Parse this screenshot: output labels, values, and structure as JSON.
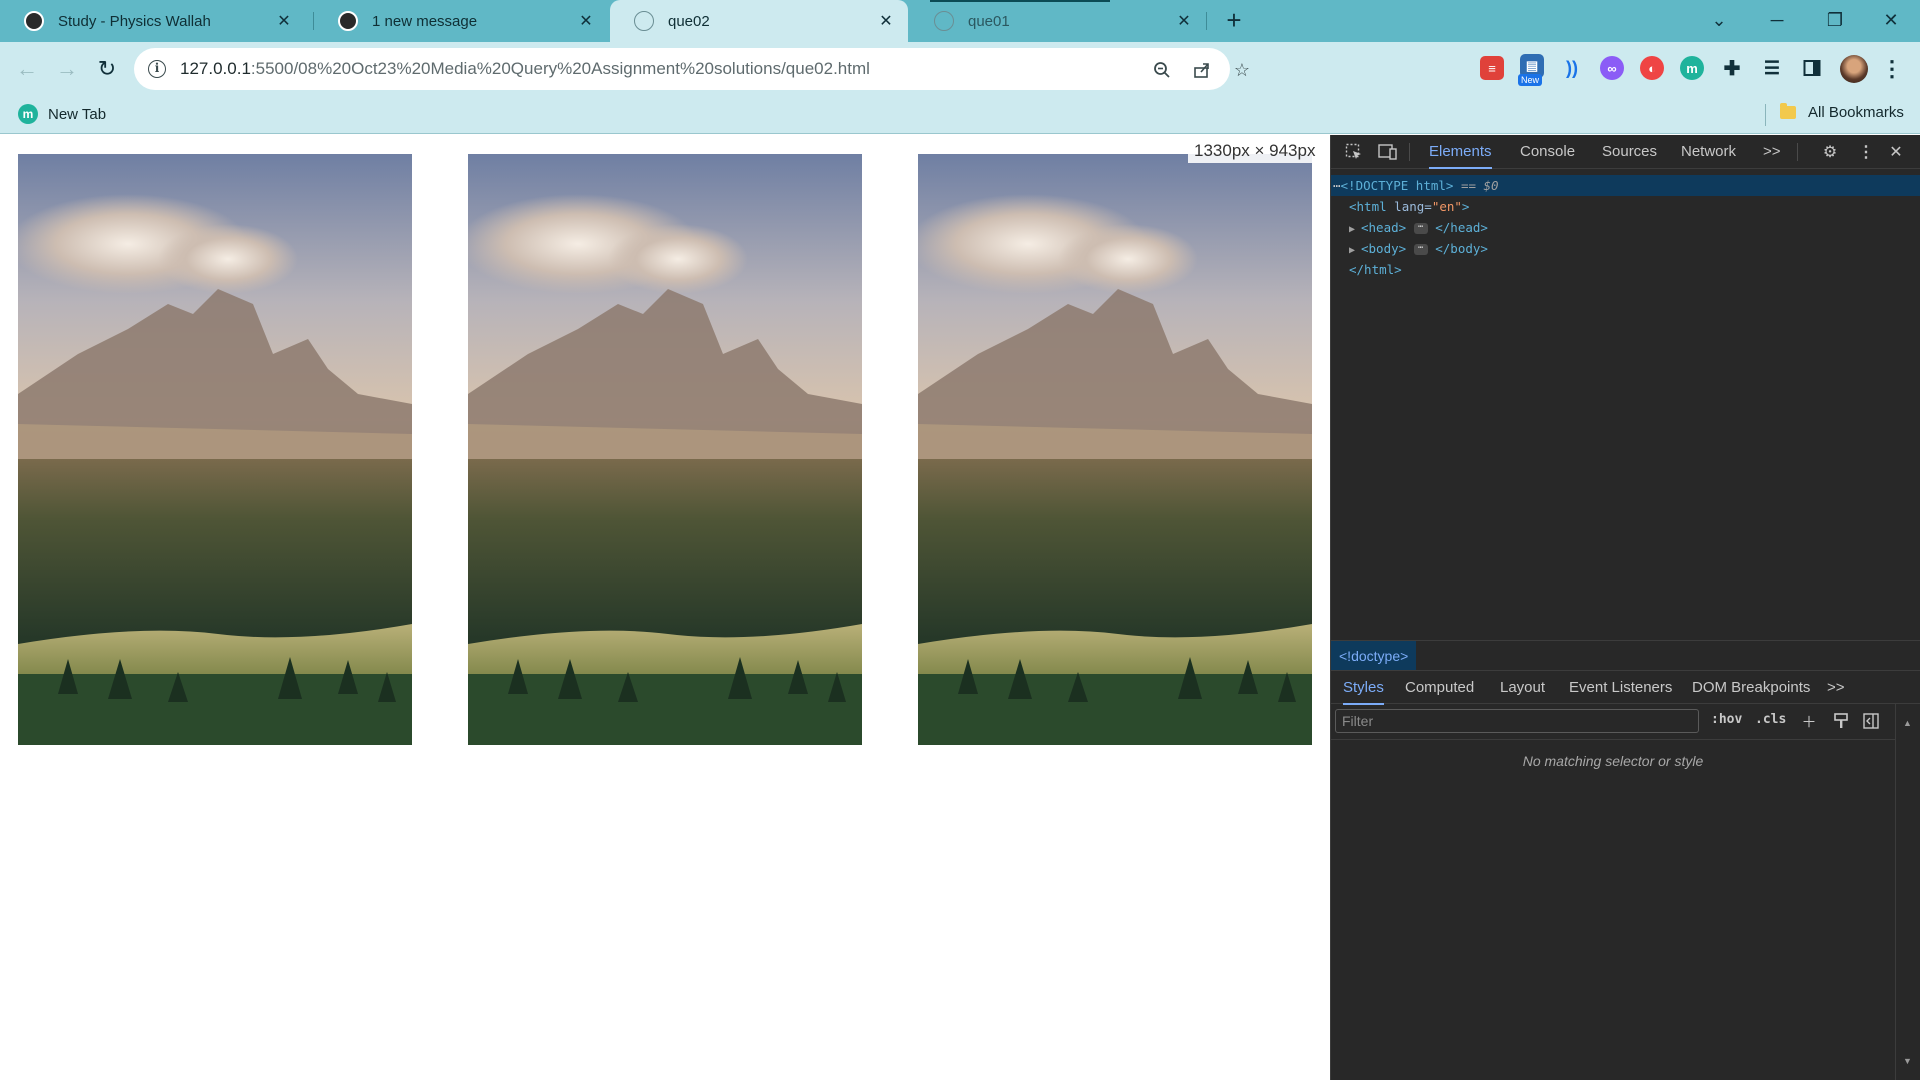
{
  "browser": {
    "tabs": [
      {
        "title": "Study - Physics Wallah",
        "favicon": "physics-wallah-icon",
        "active": false
      },
      {
        "title": "1 new message",
        "favicon": "physics-wallah-icon",
        "active": false
      },
      {
        "title": "que02",
        "favicon": "globe-icon",
        "active": true
      },
      {
        "title": "que01",
        "favicon": "globe-icon",
        "active": false
      }
    ],
    "url_host": "127.0.0.1",
    "url_path": ":5500/08%20Oct23%20Media%20Query%20Assignment%20solutions/que02.html",
    "bookmarks": [
      {
        "label": "New Tab",
        "icon": "m"
      }
    ],
    "all_bookmarks_label": "All Bookmarks",
    "extension_new_badge": "New"
  },
  "page": {
    "viewport_size_label": "1330px × 943px",
    "images": [
      {
        "subject": "mountain-landscape-photo"
      },
      {
        "subject": "mountain-landscape-photo"
      },
      {
        "subject": "mountain-landscape-photo"
      }
    ]
  },
  "devtools": {
    "tabs": [
      "Elements",
      "Console",
      "Sources",
      "Network"
    ],
    "active_tab": "Elements",
    "more_tabs": ">>",
    "dom": {
      "doctype": "<!DOCTYPE html>",
      "selected_suffix": "== $0",
      "html_open_tag": "html",
      "html_attr_name": "lang",
      "html_attr_value": "\"en\"",
      "head_tag": "head",
      "body_tag": "body",
      "html_close": "</html>"
    },
    "breadcrumb": "<!doctype>",
    "sub_tabs": [
      "Styles",
      "Computed",
      "Layout",
      "Event Listeners",
      "DOM Breakpoints"
    ],
    "sub_more": ">>",
    "filter_placeholder": "Filter",
    "hov_label": ":hov",
    "cls_label": ".cls",
    "empty_message": "No matching selector or style"
  },
  "colors": {
    "frame": "#60b8c6",
    "toolbar": "#cdeaef",
    "devtools_bg": "#282828",
    "devtools_accent": "#7cacf8"
  }
}
